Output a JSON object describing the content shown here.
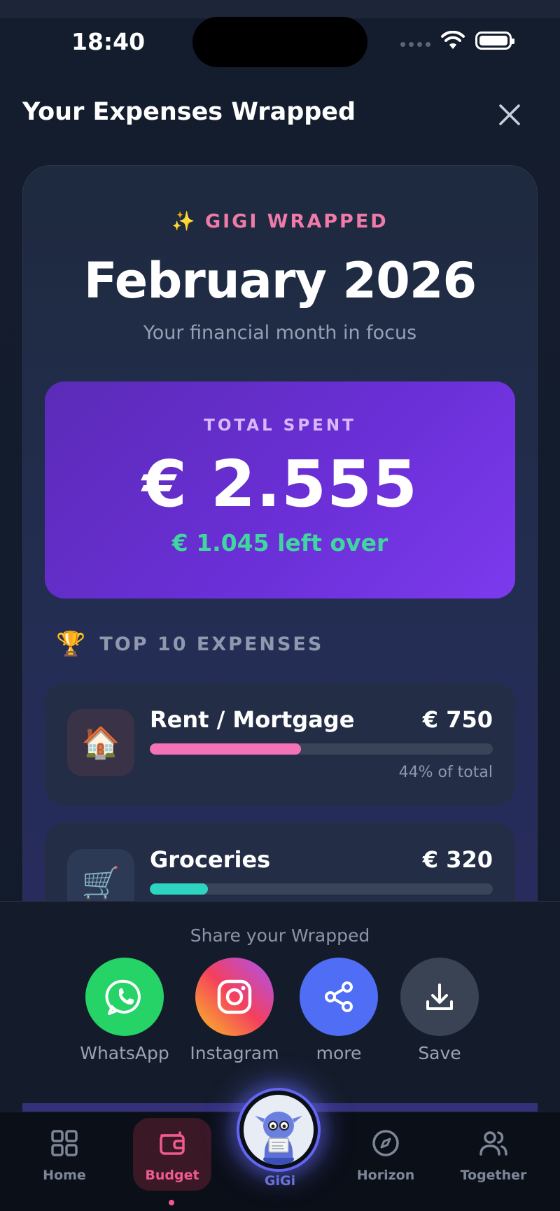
{
  "status_bar": {
    "time": "18:40"
  },
  "header": {
    "title": "Your Expenses Wrapped"
  },
  "wrapped": {
    "eyebrow": "GIGI WRAPPED",
    "eyebrow_emoji": "✨",
    "month": "February 2026",
    "subtitle": "Your financial month in focus"
  },
  "total": {
    "label": "TOTAL SPENT",
    "value": "€ 2.555",
    "left_over": "€ 1.045 left over"
  },
  "top_expenses": {
    "emoji": "🏆",
    "title": "TOP 10 EXPENSES",
    "items": [
      {
        "emoji": "🏠",
        "name": "Rent / Mortgage",
        "amount": "€ 750",
        "share": 0.44,
        "share_label": "44% of total",
        "color": "#f472b6"
      },
      {
        "emoji": "🛒",
        "name": "Groceries",
        "amount": "€ 320",
        "share": 0.17,
        "share_label": "",
        "color": "#2dd4bf"
      }
    ]
  },
  "share": {
    "title": "Share your Wrapped",
    "buttons": [
      {
        "label": "WhatsApp",
        "icon": "whatsapp-icon"
      },
      {
        "label": "Instagram",
        "icon": "instagram-icon"
      },
      {
        "label": "more",
        "icon": "share-icon"
      },
      {
        "label": "Save",
        "icon": "download-icon"
      }
    ]
  },
  "tabs": [
    {
      "label": "Home",
      "icon": "grid-icon",
      "active": false
    },
    {
      "label": "Budget",
      "icon": "wallet-icon",
      "active": true
    },
    {
      "label": "GiGi",
      "icon": "gigi-avatar",
      "active": false
    },
    {
      "label": "Horizon",
      "icon": "compass-icon",
      "active": false
    },
    {
      "label": "Together",
      "icon": "users-icon",
      "active": false
    }
  ],
  "colors": {
    "accent_pink": "#f07aa8",
    "purple_card": "#6a2fd6",
    "green": "#3fd6a0",
    "whatsapp": "#25d366",
    "more": "#4f6df5",
    "save": "#3a4354"
  }
}
